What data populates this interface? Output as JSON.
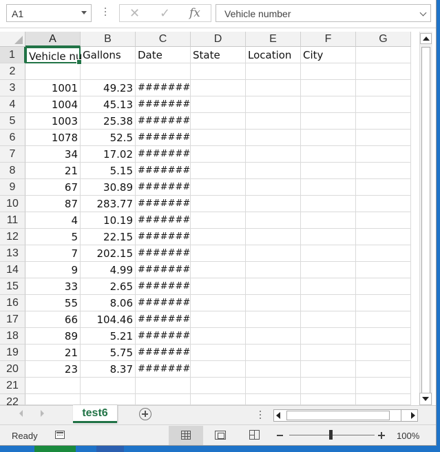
{
  "formula_bar": {
    "name_box": "A1",
    "cancel_icon": "✕",
    "enter_icon": "✓",
    "fx_label": "fx",
    "formula": "Vehicle number"
  },
  "columns": [
    "A",
    "B",
    "C",
    "D",
    "E",
    "F",
    "G"
  ],
  "active_column": "A",
  "active_row": 1,
  "header_row": [
    "Vehicle nu",
    "Gallons",
    "Date",
    "State",
    "Location",
    "City"
  ],
  "rows": [
    {
      "num": "1"
    },
    {
      "num": "2",
      "a": "",
      "b": "",
      "c": ""
    },
    {
      "num": "3",
      "a": "1001",
      "b": "49.23",
      "c": "########"
    },
    {
      "num": "4",
      "a": "1004",
      "b": "45.13",
      "c": "########"
    },
    {
      "num": "5",
      "a": "1003",
      "b": "25.38",
      "c": "########"
    },
    {
      "num": "6",
      "a": "1078",
      "b": "52.5",
      "c": "########"
    },
    {
      "num": "7",
      "a": "34",
      "b": "17.02",
      "c": "########"
    },
    {
      "num": "8",
      "a": "21",
      "b": "5.15",
      "c": "########"
    },
    {
      "num": "9",
      "a": "67",
      "b": "30.89",
      "c": "########"
    },
    {
      "num": "10",
      "a": "87",
      "b": "283.77",
      "c": "########"
    },
    {
      "num": "11",
      "a": "4",
      "b": "10.19",
      "c": "########"
    },
    {
      "num": "12",
      "a": "5",
      "b": "22.15",
      "c": "########"
    },
    {
      "num": "13",
      "a": "7",
      "b": "202.15",
      "c": "########"
    },
    {
      "num": "14",
      "a": "9",
      "b": "4.99",
      "c": "########"
    },
    {
      "num": "15",
      "a": "33",
      "b": "2.65",
      "c": "########"
    },
    {
      "num": "16",
      "a": "55",
      "b": "8.06",
      "c": "########"
    },
    {
      "num": "17",
      "a": "66",
      "b": "104.46",
      "c": "########"
    },
    {
      "num": "18",
      "a": "89",
      "b": "5.21",
      "c": "########"
    },
    {
      "num": "19",
      "a": "21",
      "b": "5.75",
      "c": "########"
    },
    {
      "num": "20",
      "a": "23",
      "b": "8.37",
      "c": "########"
    },
    {
      "num": "21",
      "a": "",
      "b": "",
      "c": ""
    },
    {
      "num": "22",
      "a": "",
      "b": "",
      "c": ""
    }
  ],
  "sheet_tab": "test6",
  "status": {
    "ready": "Ready",
    "zoom": "100%"
  },
  "colors": {
    "accent": "#217346",
    "header_bg": "#f2f2f2"
  },
  "icons": [
    "name-box-dropdown-icon",
    "cancel-icon",
    "enter-icon",
    "function-icon",
    "formula-expand-icon",
    "add-sheet-icon",
    "macro-record-icon",
    "normal-view-icon",
    "page-layout-icon",
    "page-break-icon"
  ]
}
